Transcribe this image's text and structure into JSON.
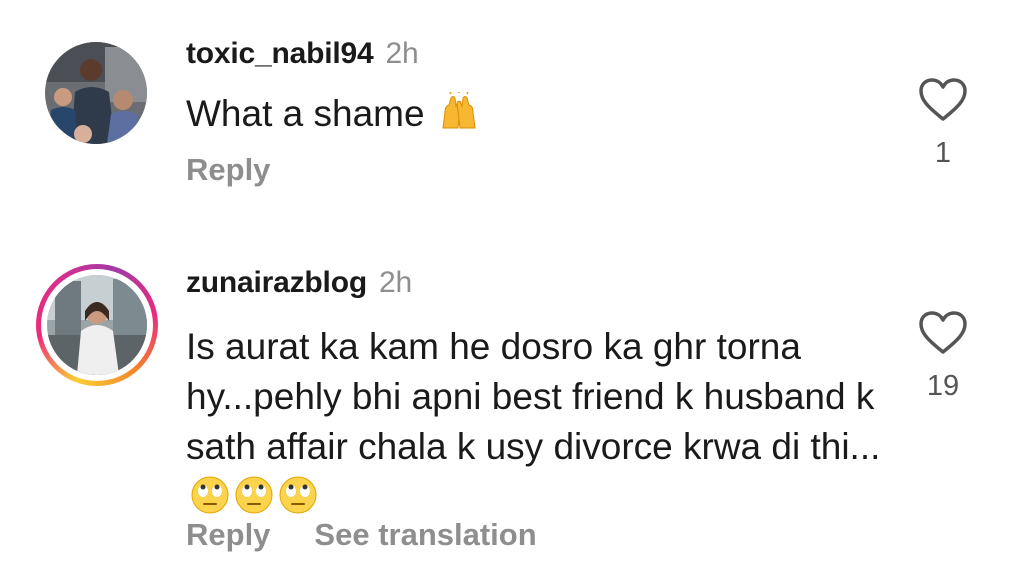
{
  "comments": [
    {
      "username": "toxic_nabil94",
      "time": "2h",
      "text": "What a shame",
      "emoji_icon": "raising-hands-emoji",
      "reply_label": "Reply",
      "like_count": "1",
      "avatar_icon": "profile-photo-group"
    },
    {
      "username": "zunairazblog",
      "time": "2h",
      "text": "Is aurat ka kam he dosro ka ghr torna hy...pehly bhi apni best friend k husband k sath affair chala k usy divorce krwa di thi...",
      "emoji_icon": "face-with-rolling-eyes-emoji",
      "reply_label": "Reply",
      "translate_label": "See translation",
      "like_count": "19",
      "avatar_icon": "profile-photo-story-ring"
    }
  ],
  "colors": {
    "text": "#1a1a1a",
    "muted": "#8e8e8e",
    "story_ring": "#ee2a7b"
  }
}
